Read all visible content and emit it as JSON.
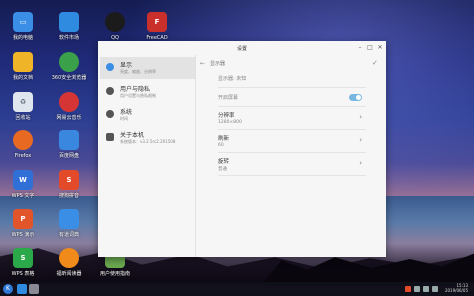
{
  "desktop": {
    "icons": [
      {
        "label": "我的电脑",
        "icon": "computer-icon",
        "color": "#3a8ee6"
      },
      {
        "label": "我的文档",
        "icon": "folder-icon",
        "color": "#f0b429"
      },
      {
        "label": "回收站",
        "icon": "recycle-bin-icon",
        "color": "#dfe6ee"
      },
      {
        "label": "Firefox",
        "icon": "firefox-icon",
        "color": "#e86a22"
      },
      {
        "label": "WPS 文字",
        "icon": "wps-writer-icon",
        "color": "#2f6fd6"
      },
      {
        "label": "WPS 演示",
        "icon": "wps-presentation-icon",
        "color": "#e2552a"
      },
      {
        "label": "WPS 表格",
        "icon": "wps-spreadsheet-icon",
        "color": "#2aa84a"
      },
      {
        "label": "软件市场",
        "icon": "software-store-icon",
        "color": "#2f8be0"
      },
      {
        "label": "360安全浏览器",
        "icon": "360-browser-icon",
        "color": "#3aa04a"
      },
      {
        "label": "网易云音乐",
        "icon": "netease-music-icon",
        "color": "#d63535"
      },
      {
        "label": "百度网盘",
        "icon": "baidu-netdisk-icon",
        "color": "#3a87e0"
      },
      {
        "label": "搜狗拼音",
        "icon": "sogou-pinyin-icon",
        "color": "#e24a2a"
      },
      {
        "label": "有道词典",
        "icon": "youdao-dict-icon",
        "color": "#3a8ee6"
      },
      {
        "label": "福昕阅读器",
        "icon": "foxit-reader-icon",
        "color": "#f08a1a"
      },
      {
        "label": "QQ",
        "icon": "qq-icon",
        "color": "#1b1b1b"
      },
      {
        "label": "用户使用指南",
        "icon": "user-guide-icon",
        "color": "#6aa84f"
      },
      {
        "label": "FreeCAD",
        "icon": "freecad-icon",
        "color": "#c9302c"
      }
    ]
  },
  "window": {
    "title": "设置",
    "controls": {
      "min": "–",
      "max": "□",
      "close": "✕"
    },
    "sidebar": [
      {
        "title": "显示",
        "subtitle": "亮度、缩放、分辨率",
        "icon": "display-icon",
        "active": true
      },
      {
        "title": "用户与隐私",
        "subtitle": "用户设置与隐私限制",
        "icon": "user-privacy-icon",
        "active": false
      },
      {
        "title": "系统",
        "subtitle": "时间",
        "icon": "system-icon",
        "active": false
      },
      {
        "title": "关于本机",
        "subtitle": "系统版本：v3.2.5rc2.201508",
        "icon": "about-icon",
        "active": false
      }
    ],
    "main": {
      "breadcrumb": "显示器",
      "rows": [
        {
          "key": "显示器: 未知",
          "value": "",
          "control": "none"
        },
        {
          "key": "开启屏幕",
          "value": "",
          "control": "toggle",
          "on": true
        },
        {
          "key": "分辨率",
          "value": "1280×800",
          "control": "chevron"
        },
        {
          "key": "刷新",
          "value": "60",
          "control": "chevron"
        },
        {
          "key": "旋转",
          "value": "普通",
          "control": "chevron"
        }
      ]
    }
  },
  "taskbar": {
    "start_label": "K",
    "clock_time": "15:13",
    "clock_date": "2019/06/05"
  }
}
